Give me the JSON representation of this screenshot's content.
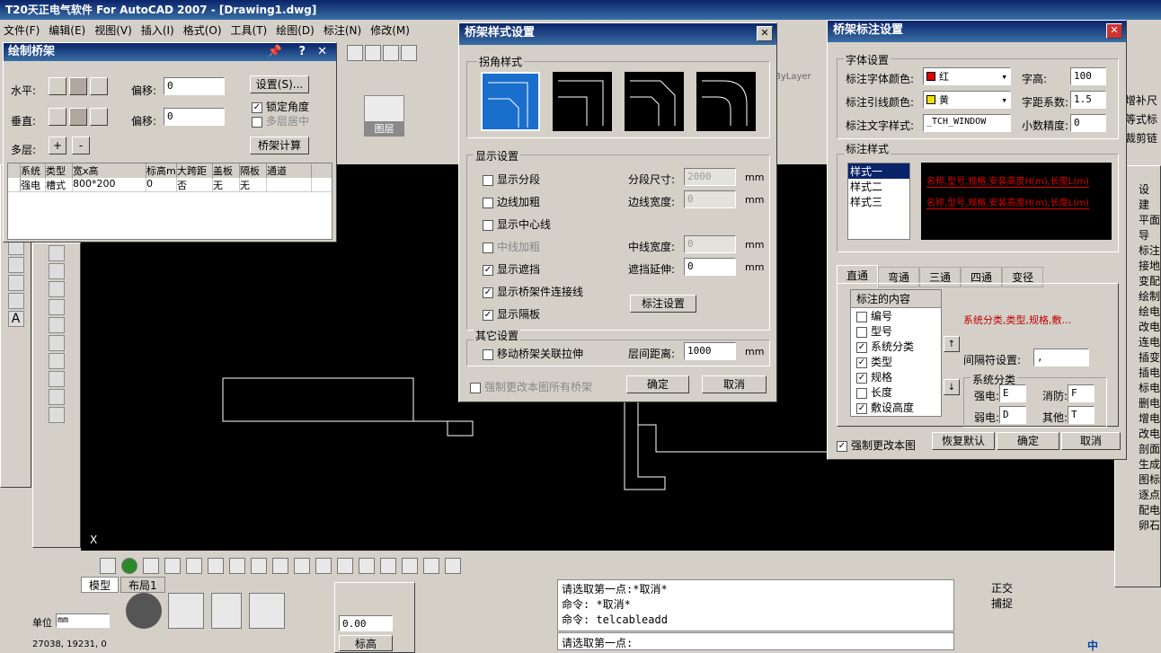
{
  "app": {
    "title": "T20天正电气软件 For AutoCAD 2007 - [Drawing1.dwg]"
  },
  "menubar": [
    "文件(F)",
    "编辑(E)",
    "视图(V)",
    "插入(I)",
    "格式(O)",
    "工具(T)",
    "绘图(D)",
    "标注(N)",
    "修改(M)"
  ],
  "toolbar": {
    "bylayer": "ByLayer",
    "layer_label": "图层",
    "right_items": [
      "增补尺",
      "等式标",
      "裁剪链"
    ],
    "right_side": [
      "设",
      "建",
      "平面",
      "导",
      "标注",
      "接地",
      "变配",
      "绘制",
      "绘电",
      "改电",
      "连电",
      "插变",
      "插电",
      "标电",
      "删电",
      "增电",
      "改电",
      "剖面",
      "生成",
      "图标",
      "逐点",
      "配电",
      "卵石"
    ]
  },
  "draw_bridge": {
    "title": "绘制桥架",
    "horizontal_label": "水平:",
    "vertical_label": "垂直:",
    "offset_label": "偏移:",
    "offset_h": "0",
    "offset_v": "0",
    "settings_button": "设置(S)...",
    "lock_angle": "锁定角度",
    "multi_layer_center": "多层居中",
    "multi_label": "多层:",
    "plus": "+",
    "minus": "-",
    "calc_button": "桥架计算",
    "columns": [
      "系统",
      "类型",
      "宽x高",
      "标高m",
      "大跨距",
      "盖板",
      "隔板",
      "通道"
    ],
    "rows": [
      [
        "强电",
        "槽式",
        "800*200",
        "0",
        "否",
        "无",
        "无",
        ""
      ]
    ]
  },
  "style_dialog": {
    "title": "桥架样式设置",
    "corner_group": "拐角样式",
    "display_group": "显示设置",
    "show_segment": "显示分段",
    "segment_size_label": "分段尺寸:",
    "segment_size": "2000",
    "bold_edge": "边线加粗",
    "edge_width_label": "边线宽度:",
    "edge_width": "0",
    "show_center": "显示中心线",
    "bold_center": "中线加粗",
    "center_width_label": "中线宽度:",
    "center_width": "0",
    "show_mask": "显示遮挡",
    "mask_extend_label": "遮挡延伸:",
    "mask_extend": "0",
    "show_connector": "显示桥架件连接线",
    "label_settings": "标注设置",
    "show_partition": "显示隔板",
    "other_group": "其它设置",
    "move_stretch": "移动桥架关联拉伸",
    "layer_spacing_label": "层间距离:",
    "layer_spacing": "1000",
    "force_change": "强制更改本图所有桥架",
    "ok": "确定",
    "cancel": "取消",
    "unit": "mm"
  },
  "label_dialog": {
    "title": "桥架标注设置",
    "font_group": "字体设置",
    "font_color_label": "标注字体颜色:",
    "font_color": "红",
    "font_color_hex": "#e00000",
    "height_label": "字高:",
    "height": "100",
    "leader_color_label": "标注引线颜色:",
    "leader_color": "黄",
    "leader_color_hex": "#f0e000",
    "spacing_label": "字距系数:",
    "spacing": "1.5",
    "text_style_label": "标注文字样式:",
    "text_style": "_TCH_WINDOW",
    "decimal_label": "小数精度:",
    "decimal": "0",
    "style_group": "标注样式",
    "styles": [
      "样式一",
      "样式二",
      "样式三"
    ],
    "preview_text": "名称,型号,规格,安装高度H(m),长度L(m)",
    "tabs": [
      "直通",
      "弯通",
      "三通",
      "四通",
      "变径"
    ],
    "content_header": "标注的内容",
    "content_preview": "系统分类,类型,规格,敷…",
    "items": [
      {
        "label": "编号",
        "checked": false
      },
      {
        "label": "型号",
        "checked": false
      },
      {
        "label": "系统分类",
        "checked": true
      },
      {
        "label": "类型",
        "checked": true
      },
      {
        "label": "规格",
        "checked": true
      },
      {
        "label": "长度",
        "checked": false
      },
      {
        "label": "敷设高度",
        "checked": true
      }
    ],
    "separator_label": "间隔符设置:",
    "separator": ",",
    "sys_group": "系统分类",
    "strong_label": "强电:",
    "strong": "E",
    "fire_label": "消防:",
    "fire": "F",
    "weak_label": "弱电:",
    "weak": "D",
    "other_label": "其他:",
    "other": "T",
    "force": "强制更改本图",
    "restore": "恢复默认",
    "ok": "确定",
    "cancel": "取消"
  },
  "layout_tabs": [
    "模型",
    "布局1"
  ],
  "cmd": {
    "lines": [
      "请选取第一点:*取消*",
      "命令: *取消*",
      "命令: telcableadd"
    ],
    "prompt": "请选取第一点:"
  },
  "status": {
    "coords": "27038, 19231, 0",
    "unit_label": "单位",
    "unit": "mm",
    "scale_value": "0.00",
    "label_btn": "标高",
    "zheng": "正交",
    "bu": "捕捉",
    "ime": "中"
  }
}
